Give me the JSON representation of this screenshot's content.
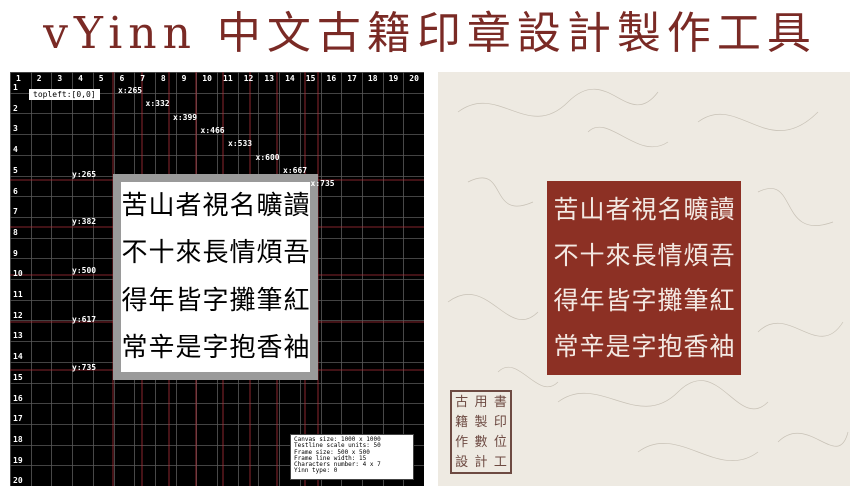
{
  "title": "vYinn 中文古籍印章設計製作工具",
  "editor": {
    "col_numbers": [
      "1",
      "2",
      "3",
      "4",
      "5",
      "6",
      "7",
      "8",
      "9",
      "10",
      "11",
      "12",
      "13",
      "14",
      "15",
      "16",
      "17",
      "18",
      "19",
      "20"
    ],
    "row_numbers": [
      "1",
      "2",
      "3",
      "4",
      "5",
      "6",
      "7",
      "8",
      "9",
      "10",
      "11",
      "12",
      "13",
      "14",
      "15",
      "16",
      "17",
      "18",
      "19",
      "20"
    ],
    "topleft": "topleft:[0,0]",
    "x_labels": [
      "x:265",
      "x:332",
      "x:399",
      "x:466",
      "x:533",
      "x:600",
      "x:667",
      "x:735"
    ],
    "y_labels": [
      "y:265",
      "y:382",
      "y:500",
      "y:617",
      "y:735"
    ],
    "seal_chars": [
      [
        "苦",
        "山",
        "者",
        "視",
        "名",
        "曠",
        "讀"
      ],
      [
        "不",
        "十",
        "來",
        "長",
        "情",
        "煩",
        "吾"
      ],
      [
        "得",
        "年",
        "皆",
        "字",
        "攤",
        "筆",
        "紅"
      ],
      [
        "常",
        "辛",
        "是",
        "字",
        "抱",
        "香",
        "袖"
      ]
    ],
    "info": {
      "canvas": "Canvas size: 1000 x 1000",
      "testline": "Testline scale units: 50",
      "frame": "Frame size: 500 x 500",
      "frame_line": "Frame line width: 15",
      "characters": "Characters number: 4 x 7",
      "yinn_type": "Yinn type: 0"
    }
  },
  "stamp_chars": [
    "古",
    "用",
    "書",
    "籍",
    "製",
    "印",
    "作",
    "數",
    "位",
    "設",
    "計",
    "工"
  ],
  "colors": {
    "title": "#7a2a25",
    "seal": "#8c3024",
    "paper": "#eeeae2",
    "gridline_red": "#b0303a"
  }
}
